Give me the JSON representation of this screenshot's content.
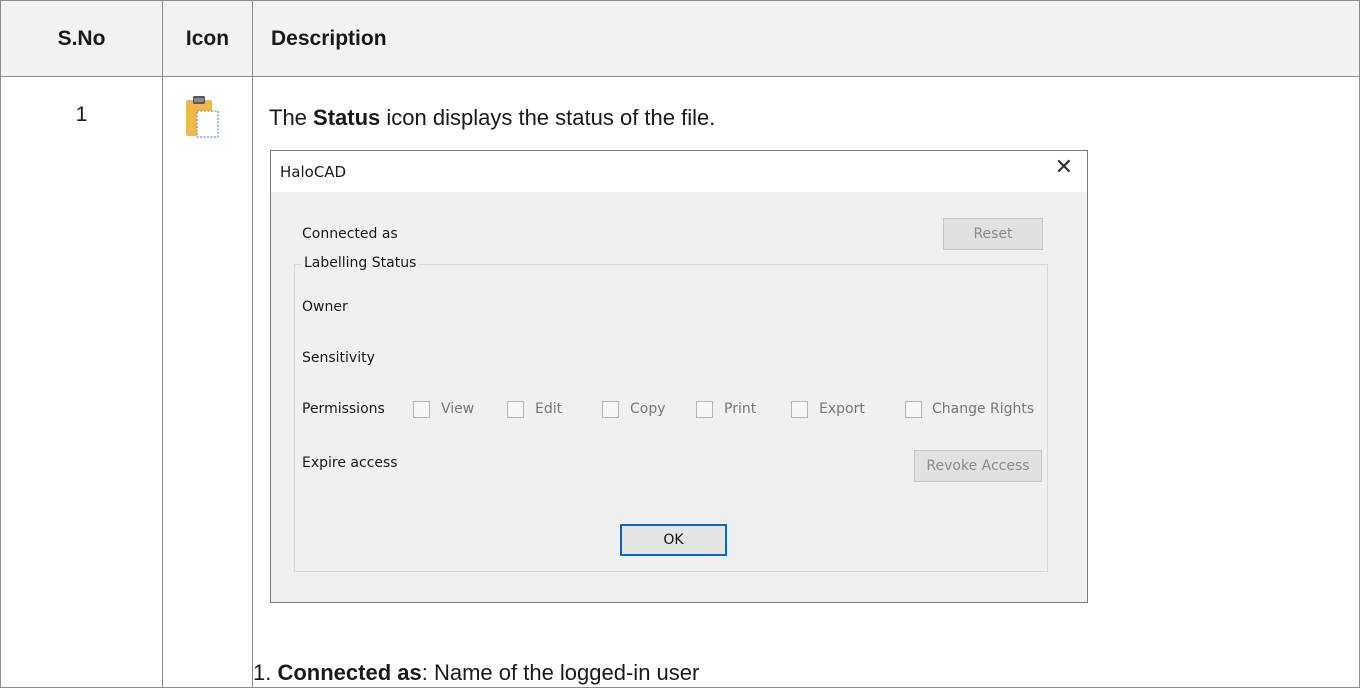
{
  "table": {
    "headers": {
      "sno": "S.No",
      "icon": "Icon",
      "description": "Description"
    },
    "row": {
      "sno": "1",
      "intro_prefix": "The ",
      "intro_bold": "Status",
      "intro_suffix": " icon displays the status of the file.",
      "note_number": "1. ",
      "note_bold": "Connected as",
      "note_text": ": Name of the logged-in user"
    }
  },
  "icon": {
    "name": "clipboard-icon",
    "color": "#f0b84a"
  },
  "dialog": {
    "title": "HaloCAD",
    "close_glyph": "✕",
    "connected_as_label": "Connected as",
    "reset_label": "Reset",
    "group_label": "Labelling Status",
    "owner_label": "Owner",
    "sensitivity_label": "Sensitivity",
    "permissions_label": "Permissions",
    "permissions": [
      "View",
      "Edit",
      "Copy",
      "Print",
      "Export",
      "Change Rights"
    ],
    "expire_label": "Expire access",
    "revoke_label": "Revoke Access",
    "ok_label": "OK"
  }
}
